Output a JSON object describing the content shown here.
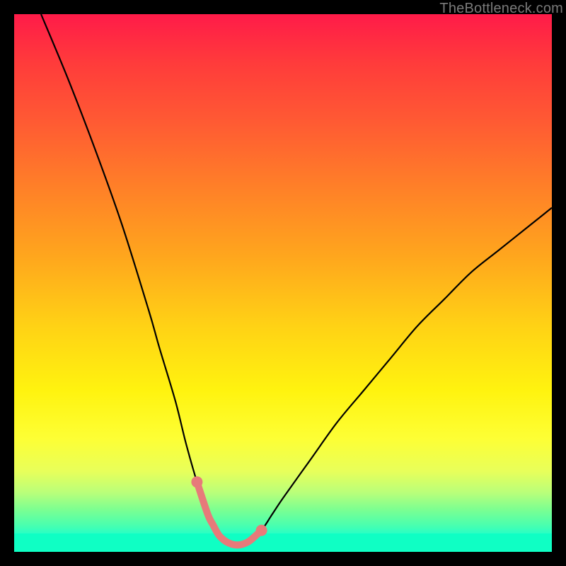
{
  "watermark": "TheBottleneck.com",
  "colors": {
    "frame": "#000000",
    "curve": "#000000",
    "marker": "#e77a7a",
    "gradient_top": "#ff1b49",
    "gradient_bottom": "#0fffdf"
  },
  "chart_data": {
    "type": "line",
    "title": "",
    "xlabel": "",
    "ylabel": "",
    "xlim": [
      0,
      100
    ],
    "ylim": [
      0,
      100
    ],
    "series": [
      {
        "name": "bottleneck-curve",
        "x": [
          5,
          10,
          15,
          20,
          25,
          27,
          30,
          32,
          34,
          36,
          37,
          38,
          39,
          40,
          41,
          42,
          43,
          44,
          46,
          48,
          50,
          55,
          60,
          65,
          70,
          75,
          80,
          85,
          90,
          95,
          100
        ],
        "values": [
          100,
          88,
          75,
          61,
          45,
          38,
          28,
          20,
          13,
          7,
          5,
          3.2,
          2.2,
          1.6,
          1.3,
          1.3,
          1.6,
          2.2,
          4,
          7,
          10,
          17,
          24,
          30,
          36,
          42,
          47,
          52,
          56,
          60,
          64
        ]
      }
    ],
    "markers": {
      "name": "valley-highlight",
      "x": [
        34,
        36,
        37,
        38,
        39,
        40,
        41,
        42,
        43,
        44,
        46
      ],
      "values": [
        13,
        7,
        5,
        3.2,
        2.2,
        1.6,
        1.3,
        1.3,
        1.6,
        2.2,
        4
      ],
      "point_radius": 7,
      "line_width": 10
    },
    "background": "vertical-gradient"
  }
}
